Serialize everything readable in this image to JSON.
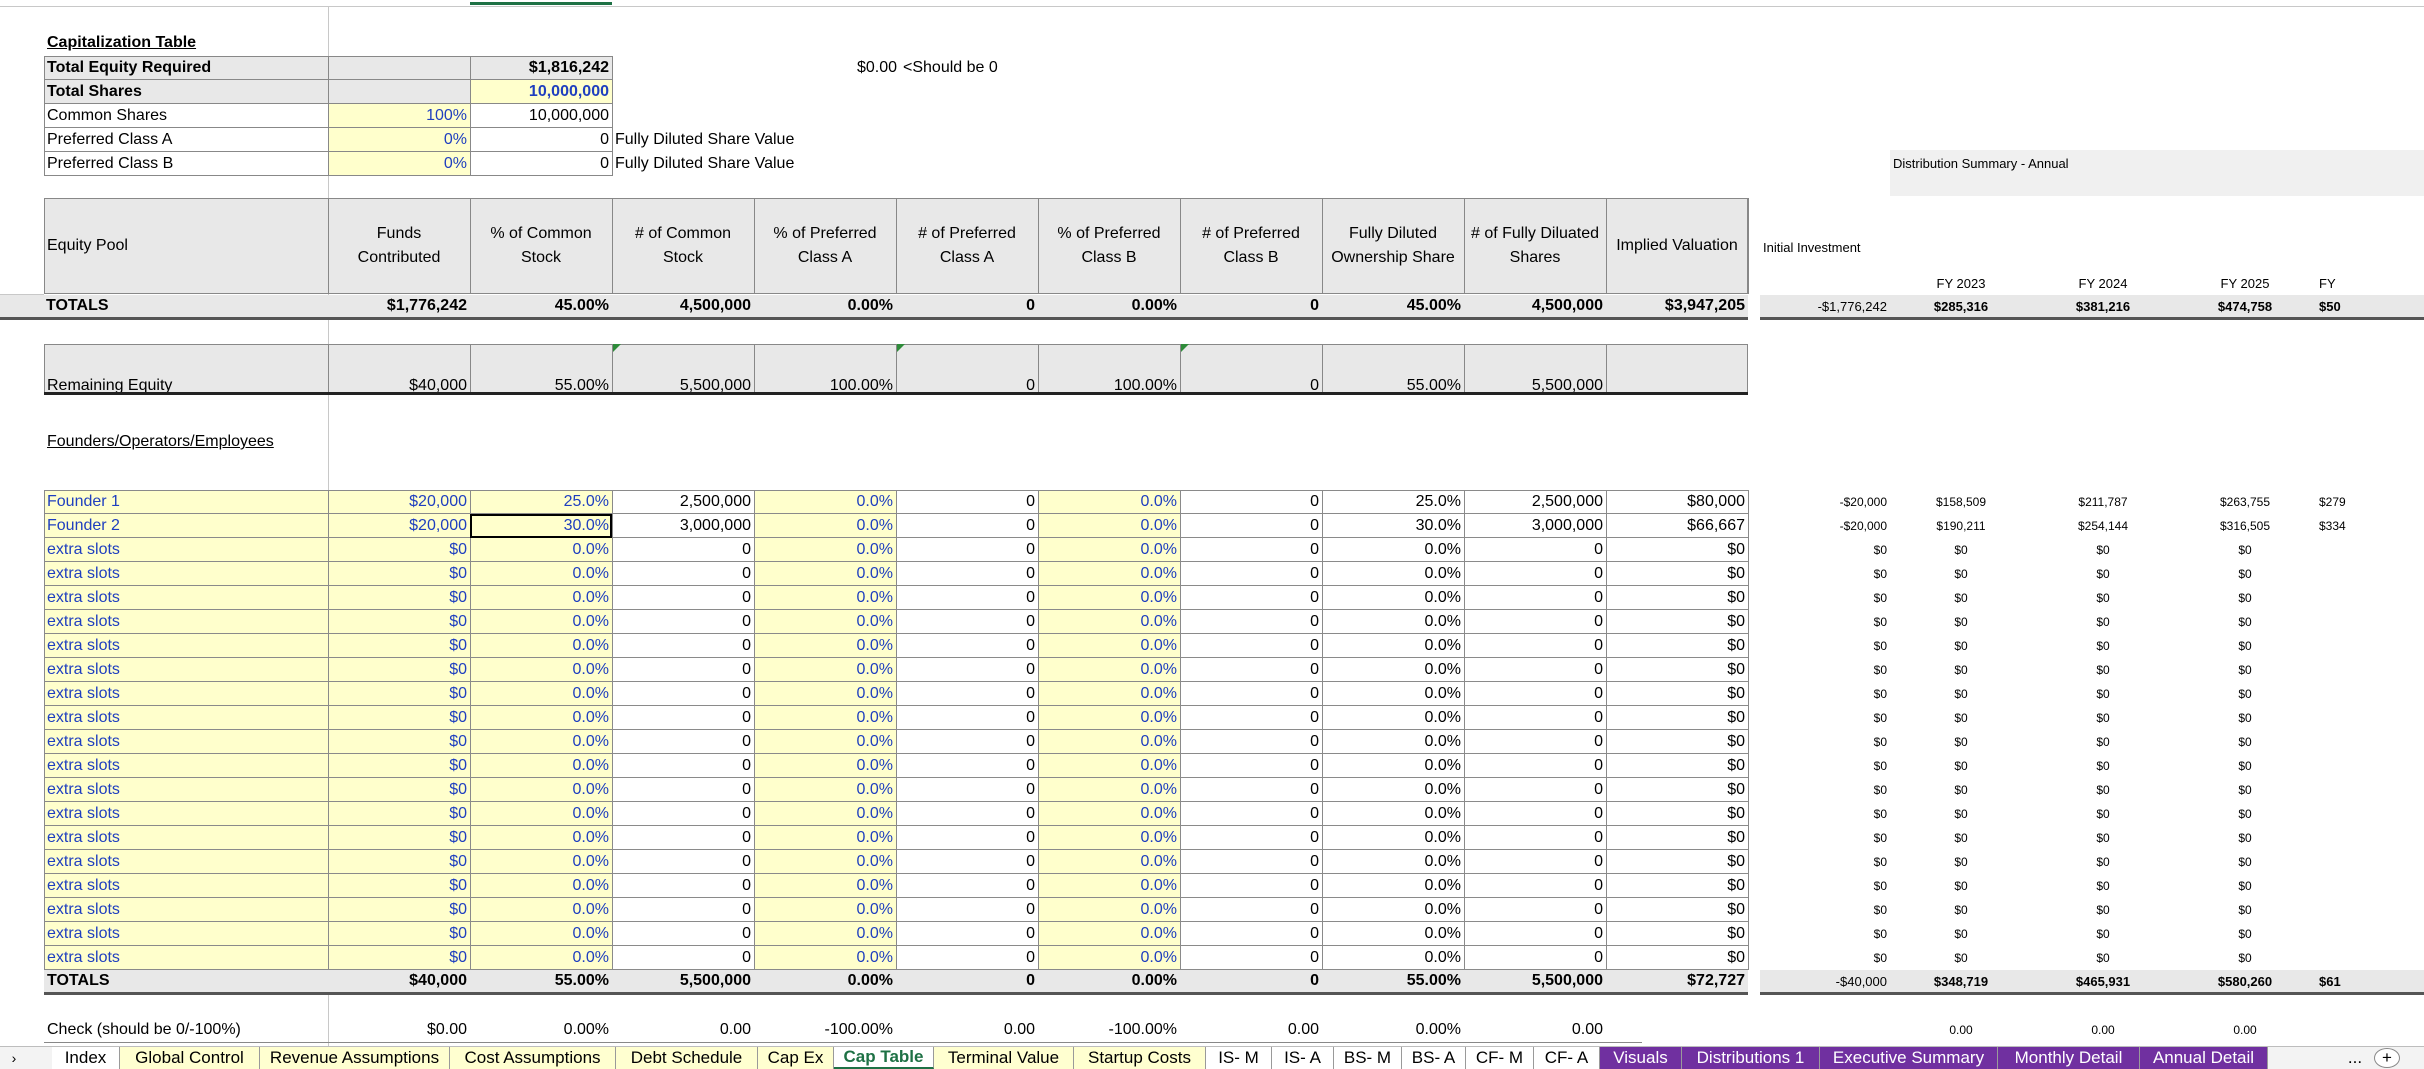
{
  "cap": {
    "title": "Capitalization Table",
    "rows": [
      {
        "label": "Total Equity Required",
        "pct": "",
        "val": "$1,816,242",
        "bold": true
      },
      {
        "label": "Total Shares",
        "pct": "",
        "val": "10,000,000",
        "bold": true
      },
      {
        "label": "Common Shares",
        "pct": "100%",
        "val": "10,000,000"
      },
      {
        "label": "Preferred Class A",
        "pct": "0%",
        "val": "0"
      },
      {
        "label": "Preferred Class B",
        "pct": "0%",
        "val": "0"
      }
    ],
    "check_value": "$0.00",
    "check_note": "<Should be 0",
    "fdsv_a": "Fully Diluted Share Value",
    "fdsv_b": "Fully Diluted Share Value"
  },
  "headers": [
    "Equity Pool",
    "Funds Contributed",
    "% of Common Stock",
    "# of Common Stock",
    "% of Preferred Class A",
    "# of Preferred Class A",
    "% of Preferred Class B",
    "# of Preferred Class B",
    "Fully Diluted Ownership Share",
    "# of Fully Diluated Shares",
    "Implied Valuation"
  ],
  "totals": [
    "TOTALS",
    "$1,776,242",
    "45.00%",
    "4,500,000",
    "0.00%",
    "0",
    "0.00%",
    "0",
    "45.00%",
    "4,500,000",
    "$3,947,205"
  ],
  "remaining": [
    "Remaining Equity",
    "$40,000",
    "55.00%",
    "5,500,000",
    "100.00%",
    "0",
    "100.00%",
    "0",
    "55.00%",
    "5,500,000",
    ""
  ],
  "founders_title": "Founders/Operators/Employees",
  "founders": [
    [
      "Founder 1",
      "$20,000",
      "25.0%",
      "2,500,000",
      "0.0%",
      "0",
      "0.0%",
      "0",
      "25.0%",
      "2,500,000",
      "$80,000"
    ],
    [
      "Founder 2",
      "$20,000",
      "30.0%",
      "3,000,000",
      "0.0%",
      "0",
      "0.0%",
      "0",
      "30.0%",
      "3,000,000",
      "$66,667"
    ],
    [
      "extra slots",
      "$0",
      "0.0%",
      "0",
      "0.0%",
      "0",
      "0.0%",
      "0",
      "0.0%",
      "0",
      "$0"
    ],
    [
      "extra slots",
      "$0",
      "0.0%",
      "0",
      "0.0%",
      "0",
      "0.0%",
      "0",
      "0.0%",
      "0",
      "$0"
    ],
    [
      "extra slots",
      "$0",
      "0.0%",
      "0",
      "0.0%",
      "0",
      "0.0%",
      "0",
      "0.0%",
      "0",
      "$0"
    ],
    [
      "extra slots",
      "$0",
      "0.0%",
      "0",
      "0.0%",
      "0",
      "0.0%",
      "0",
      "0.0%",
      "0",
      "$0"
    ],
    [
      "extra slots",
      "$0",
      "0.0%",
      "0",
      "0.0%",
      "0",
      "0.0%",
      "0",
      "0.0%",
      "0",
      "$0"
    ],
    [
      "extra slots",
      "$0",
      "0.0%",
      "0",
      "0.0%",
      "0",
      "0.0%",
      "0",
      "0.0%",
      "0",
      "$0"
    ],
    [
      "extra slots",
      "$0",
      "0.0%",
      "0",
      "0.0%",
      "0",
      "0.0%",
      "0",
      "0.0%",
      "0",
      "$0"
    ],
    [
      "extra slots",
      "$0",
      "0.0%",
      "0",
      "0.0%",
      "0",
      "0.0%",
      "0",
      "0.0%",
      "0",
      "$0"
    ],
    [
      "extra slots",
      "$0",
      "0.0%",
      "0",
      "0.0%",
      "0",
      "0.0%",
      "0",
      "0.0%",
      "0",
      "$0"
    ],
    [
      "extra slots",
      "$0",
      "0.0%",
      "0",
      "0.0%",
      "0",
      "0.0%",
      "0",
      "0.0%",
      "0",
      "$0"
    ],
    [
      "extra slots",
      "$0",
      "0.0%",
      "0",
      "0.0%",
      "0",
      "0.0%",
      "0",
      "0.0%",
      "0",
      "$0"
    ],
    [
      "extra slots",
      "$0",
      "0.0%",
      "0",
      "0.0%",
      "0",
      "0.0%",
      "0",
      "0.0%",
      "0",
      "$0"
    ],
    [
      "extra slots",
      "$0",
      "0.0%",
      "0",
      "0.0%",
      "0",
      "0.0%",
      "0",
      "0.0%",
      "0",
      "$0"
    ],
    [
      "extra slots",
      "$0",
      "0.0%",
      "0",
      "0.0%",
      "0",
      "0.0%",
      "0",
      "0.0%",
      "0",
      "$0"
    ],
    [
      "extra slots",
      "$0",
      "0.0%",
      "0",
      "0.0%",
      "0",
      "0.0%",
      "0",
      "0.0%",
      "0",
      "$0"
    ],
    [
      "extra slots",
      "$0",
      "0.0%",
      "0",
      "0.0%",
      "0",
      "0.0%",
      "0",
      "0.0%",
      "0",
      "$0"
    ],
    [
      "extra slots",
      "$0",
      "0.0%",
      "0",
      "0.0%",
      "0",
      "0.0%",
      "0",
      "0.0%",
      "0",
      "$0"
    ],
    [
      "extra slots",
      "$0",
      "0.0%",
      "0",
      "0.0%",
      "0",
      "0.0%",
      "0",
      "0.0%",
      "0",
      "$0"
    ]
  ],
  "founders_totals": [
    "TOTALS",
    "$40,000",
    "55.00%",
    "5,500,000",
    "0.00%",
    "0",
    "0.00%",
    "0",
    "55.00%",
    "5,500,000",
    "$72,727"
  ],
  "check_row": [
    "Check (should be 0/-100%)",
    "$0.00",
    "0.00%",
    "0.00",
    "-100.00%",
    "0.00",
    "-100.00%",
    "0.00",
    "0.00%",
    "0.00",
    ""
  ],
  "dist": {
    "title": "Distribution Summary - Annual",
    "initial_header": "Initial Investment",
    "years": [
      "FY 2023",
      "FY 2024",
      "FY 2025",
      "FY"
    ],
    "totals": [
      "-$1,776,242",
      "$285,316",
      "$381,216",
      "$474,758",
      "$50"
    ],
    "founders": [
      [
        "-$20,000",
        "$158,509",
        "$211,787",
        "$263,755",
        "$279"
      ],
      [
        "-$20,000",
        "$190,211",
        "$254,144",
        "$316,505",
        "$334"
      ],
      [
        "$0",
        "$0",
        "$0",
        "$0",
        ""
      ],
      [
        "$0",
        "$0",
        "$0",
        "$0",
        ""
      ],
      [
        "$0",
        "$0",
        "$0",
        "$0",
        ""
      ],
      [
        "$0",
        "$0",
        "$0",
        "$0",
        ""
      ],
      [
        "$0",
        "$0",
        "$0",
        "$0",
        ""
      ],
      [
        "$0",
        "$0",
        "$0",
        "$0",
        ""
      ],
      [
        "$0",
        "$0",
        "$0",
        "$0",
        ""
      ],
      [
        "$0",
        "$0",
        "$0",
        "$0",
        ""
      ],
      [
        "$0",
        "$0",
        "$0",
        "$0",
        ""
      ],
      [
        "$0",
        "$0",
        "$0",
        "$0",
        ""
      ],
      [
        "$0",
        "$0",
        "$0",
        "$0",
        ""
      ],
      [
        "$0",
        "$0",
        "$0",
        "$0",
        ""
      ],
      [
        "$0",
        "$0",
        "$0",
        "$0",
        ""
      ],
      [
        "$0",
        "$0",
        "$0",
        "$0",
        ""
      ],
      [
        "$0",
        "$0",
        "$0",
        "$0",
        ""
      ],
      [
        "$0",
        "$0",
        "$0",
        "$0",
        ""
      ],
      [
        "$0",
        "$0",
        "$0",
        "$0",
        ""
      ],
      [
        "$0",
        "$0",
        "$0",
        "$0",
        ""
      ]
    ],
    "founders_totals": [
      "-$40,000",
      "$348,719",
      "$465,931",
      "$580,260",
      "$61"
    ],
    "check": [
      "",
      "0.00",
      "0.00",
      "0.00",
      ""
    ]
  },
  "tabs": [
    {
      "label": "Index",
      "style": "wht",
      "w": 68
    },
    {
      "label": "Global Control",
      "style": "yel",
      "w": 140
    },
    {
      "label": "Revenue Assumptions",
      "style": "yel",
      "w": 190
    },
    {
      "label": "Cost Assumptions",
      "style": "yel",
      "w": 166
    },
    {
      "label": "Debt Schedule",
      "style": "yel",
      "w": 142
    },
    {
      "label": "Cap Ex",
      "style": "yel",
      "w": 76
    },
    {
      "label": "Cap Table",
      "style": "act",
      "w": 100
    },
    {
      "label": "Terminal Value",
      "style": "yel",
      "w": 140
    },
    {
      "label": "Startup Costs",
      "style": "yel",
      "w": 132
    },
    {
      "label": "IS- M",
      "style": "wht",
      "w": 66
    },
    {
      "label": "IS- A",
      "style": "wht",
      "w": 62
    },
    {
      "label": "BS- M",
      "style": "wht",
      "w": 68
    },
    {
      "label": "BS- A",
      "style": "wht",
      "w": 64
    },
    {
      "label": "CF- M",
      "style": "wht",
      "w": 68
    },
    {
      "label": "CF- A",
      "style": "wht",
      "w": 66
    },
    {
      "label": "Visuals",
      "style": "pur",
      "w": 82
    },
    {
      "label": "Distributions 1",
      "style": "pur",
      "w": 138
    },
    {
      "label": "Executive Summary",
      "style": "pur",
      "w": 178
    },
    {
      "label": "Monthly Detail",
      "style": "pur",
      "w": 142
    },
    {
      "label": "Annual Detail",
      "style": "pur",
      "w": 128
    }
  ],
  "tab_more": "...",
  "tab_add": "+",
  "tab_nav": "›",
  "colors": {
    "yellow": "#ffffcc",
    "grey": "#e8e8e8",
    "blue": "#1f3fbf",
    "purple": "#7030a0",
    "green": "#1e7145"
  }
}
